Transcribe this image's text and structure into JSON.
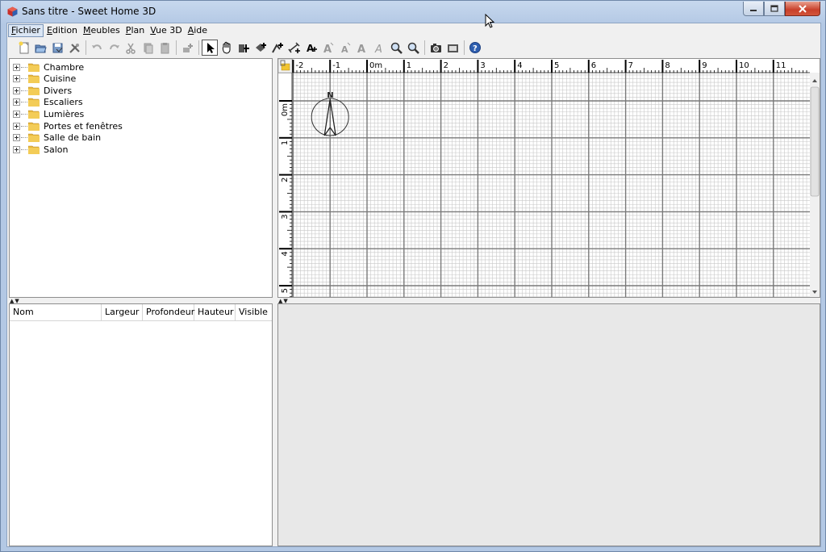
{
  "window": {
    "title": "Sans titre - Sweet Home 3D"
  },
  "menu": {
    "items": [
      {
        "label": "Fichier",
        "active": true
      },
      {
        "label": "Edition"
      },
      {
        "label": "Meubles"
      },
      {
        "label": "Plan"
      },
      {
        "label": "Vue 3D"
      },
      {
        "label": "Aide"
      }
    ]
  },
  "toolbar": {
    "groups": [
      [
        "new-home-icon",
        "open-icon",
        "save-icon",
        "preferences-icon"
      ],
      [
        "undo-icon",
        "redo-icon",
        "cut-icon",
        "copy-icon",
        "paste-icon"
      ],
      [
        "add-furniture-icon"
      ],
      [
        "select-mode-icon",
        "pan-mode-icon",
        "create-walls-icon",
        "create-rooms-icon",
        "create-polylines-icon",
        "create-dimensions-icon",
        "add-text-icon",
        "increase-text-icon",
        "decrease-text-icon",
        "bold-text-icon",
        "italic-text-icon",
        "zoom-in-icon",
        "zoom-out-icon"
      ],
      [
        "create-photo-icon",
        "create-video-icon"
      ],
      [
        "help-icon"
      ]
    ],
    "selected": "select-mode-icon"
  },
  "catalog": {
    "categories": [
      "Chambre",
      "Cuisine",
      "Divers",
      "Escaliers",
      "Lumières",
      "Portes et fenêtres",
      "Salle de bain",
      "Salon"
    ]
  },
  "furniture_table": {
    "columns": [
      "Nom",
      "Largeur",
      "Profondeur",
      "Hauteur",
      "Visible"
    ]
  },
  "plan": {
    "x_ruler_labels": [
      "-2",
      "-1",
      "0m",
      "1",
      "2",
      "3",
      "4",
      "5",
      "6",
      "7",
      "8",
      "9",
      "10",
      "11"
    ],
    "y_ruler_labels": [
      "0m",
      "1",
      "2",
      "3",
      "4",
      "5"
    ],
    "compass_label": "N"
  },
  "colors": {
    "folder": "#e8b83a",
    "grid_major": "#7a7a7a",
    "grid_minor": "#c8c8c8",
    "help_blue": "#2f5fb0"
  }
}
